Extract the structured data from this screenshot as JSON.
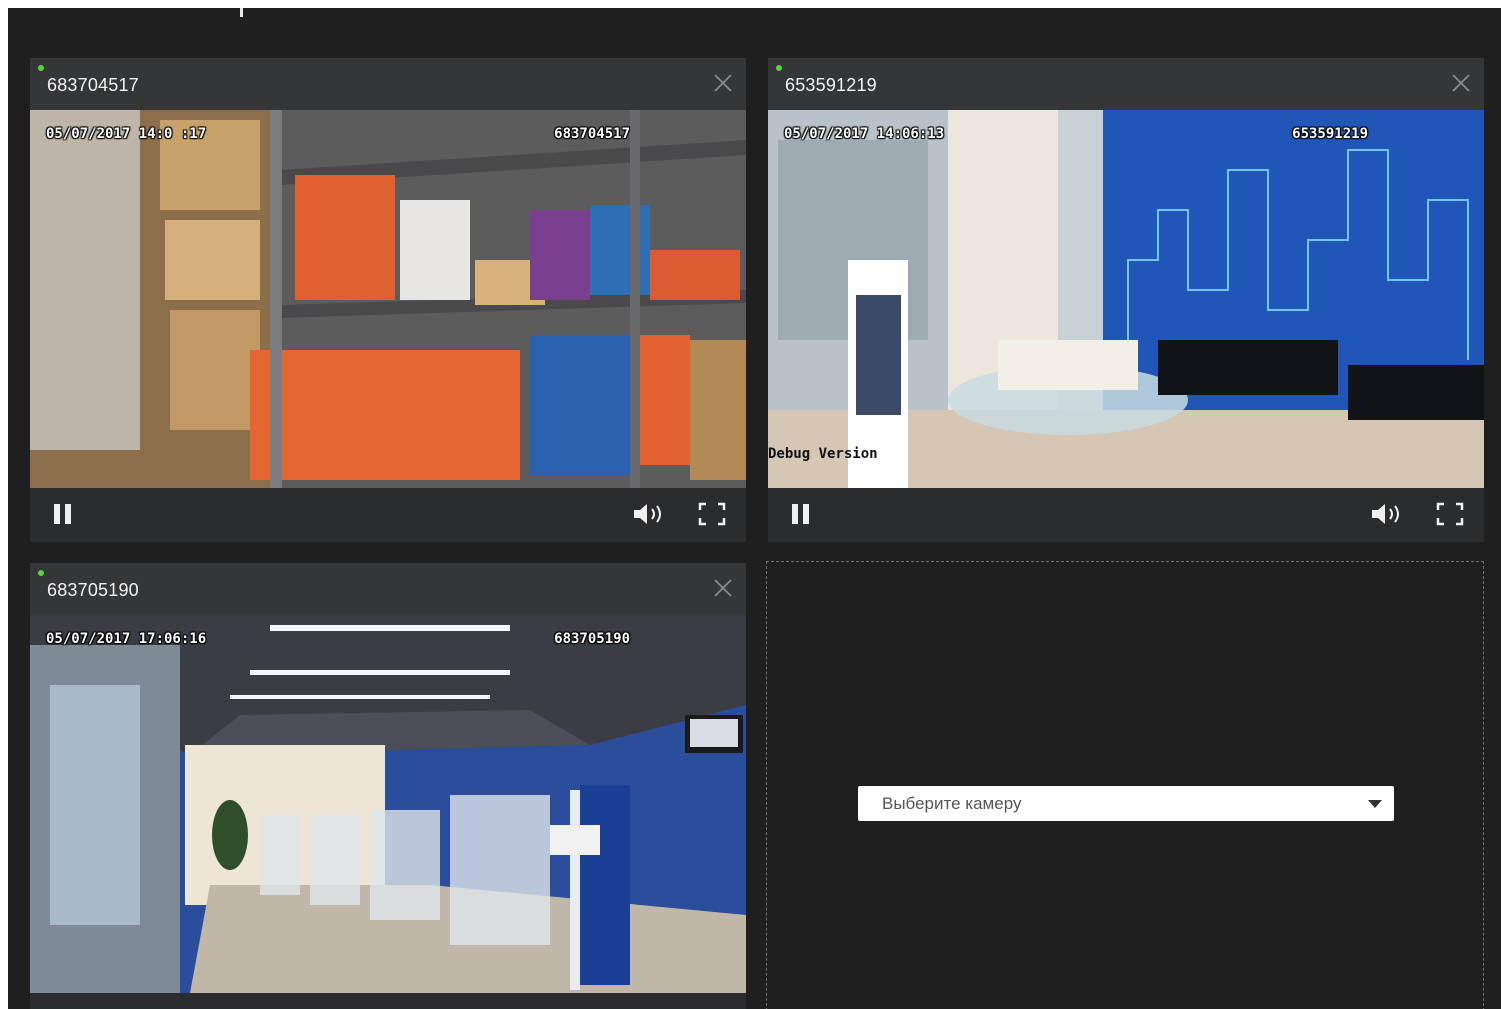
{
  "colors": {
    "background": "#1f1f1f",
    "tile": "#2b2c2e",
    "tile_header": "#353638",
    "status_online": "#5ad23a",
    "text": "#f2f2f2"
  },
  "cameras": [
    {
      "id_label": "683704517",
      "status": "online",
      "osd_timestamp": "05/07/2017 14:0  :17",
      "osd_id": "683704517",
      "icons": {
        "close": "close-icon",
        "pause": "pause-icon",
        "volume": "volume-icon",
        "fullscreen": "fullscreen-icon"
      }
    },
    {
      "id_label": "653591219",
      "status": "online",
      "osd_timestamp": "05/07/2017 14:06:13",
      "osd_id": "653591219",
      "osd_debug": "Debug Version",
      "icons": {
        "close": "close-icon",
        "pause": "pause-icon",
        "volume": "volume-icon",
        "fullscreen": "fullscreen-icon"
      }
    },
    {
      "id_label": "683705190",
      "status": "online",
      "osd_timestamp": "05/07/2017 17:06:16",
      "osd_id": "683705190",
      "icons": {
        "close": "close-icon"
      }
    }
  ],
  "empty_slot": {
    "select_placeholder": "Выберите камеру",
    "icon": "chevron-down-icon"
  }
}
